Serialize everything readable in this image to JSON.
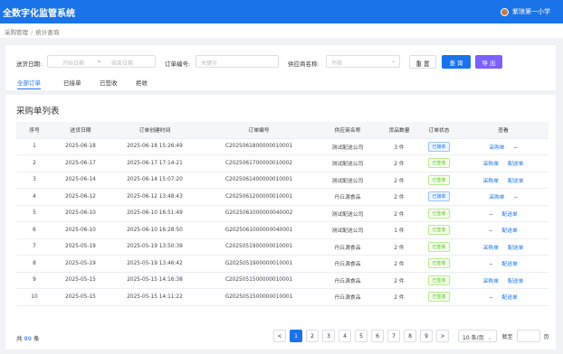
{
  "header": {
    "title": "全数字化监管系统",
    "user": "紫琅第一小学"
  },
  "breadcrumb": [
    "采购管理",
    "统计查询"
  ],
  "filters": {
    "date_label": "送货日期:",
    "date_start_placeholder": "开始日期",
    "date_sep": "~",
    "date_end_placeholder": "结束日期",
    "order_label": "订单编号:",
    "order_placeholder": "关键字",
    "supplier_label": "供应商名称:",
    "supplier_placeholder": "不限",
    "reset_label": "重 置",
    "search_label": "查 询",
    "export_label": "导 出"
  },
  "tabs": [
    {
      "label": "全部订单",
      "active": true
    },
    {
      "label": "已接单",
      "active": false
    },
    {
      "label": "已签收",
      "active": false
    },
    {
      "label": "拒收",
      "active": false
    }
  ],
  "section_title": "采购单列表",
  "columns": [
    "序号",
    "送货日期",
    "订单创建时间",
    "订单编号",
    "供应商名称",
    "货品数量",
    "订单状态",
    "查看"
  ],
  "rows": [
    {
      "no": "1",
      "date": "2025-06-18",
      "created": "2025-06-18 15:26:49",
      "order": "C2025061800000010001",
      "supplier": "测试配送公司",
      "qty": "3 件",
      "status": "已接单",
      "status_type": "blue",
      "view": [
        "采购单",
        "--"
      ]
    },
    {
      "no": "2",
      "date": "2025-06-17",
      "created": "2025-06-17 17:14:21",
      "order": "C2025061700000010002",
      "supplier": "测试配送公司",
      "qty": "2 件",
      "status": "已签收",
      "status_type": "green",
      "view": [
        "采购单",
        "配送单"
      ]
    },
    {
      "no": "3",
      "date": "2025-06-14",
      "created": "2025-06-14 15:07:20",
      "order": "C2025061400000010001",
      "supplier": "测试配送公司",
      "qty": "2 件",
      "status": "已签收",
      "status_type": "green",
      "view": [
        "采购单",
        "配送单"
      ]
    },
    {
      "no": "4",
      "date": "2025-06-12",
      "created": "2025-06-12 13:48:43",
      "order": "C2025061200000010001",
      "supplier": "丹丘源食品",
      "qty": "2 件",
      "status": "已接单",
      "status_type": "blue",
      "view": [
        "采购单",
        "--"
      ]
    },
    {
      "no": "5",
      "date": "2025-06-10",
      "created": "2025-06-10 16:51:49",
      "order": "G2025061000000040002",
      "supplier": "测试配送公司",
      "qty": "2 件",
      "status": "已签收",
      "status_type": "green",
      "view": [
        "--",
        "配送单"
      ]
    },
    {
      "no": "6",
      "date": "2025-06-10",
      "created": "2025-06-10 16:28:50",
      "order": "G2025061000000040001",
      "supplier": "测试配送公司",
      "qty": "1 件",
      "status": "已签收",
      "status_type": "green",
      "view": [
        "--",
        "配送单"
      ]
    },
    {
      "no": "7",
      "date": "2025-05-19",
      "created": "2025-05-19 13:50:39",
      "order": "C2025051900000010001",
      "supplier": "丹丘源食品",
      "qty": "2 件",
      "status": "已签收",
      "status_type": "green",
      "view": [
        "采购单",
        "配送单"
      ]
    },
    {
      "no": "8",
      "date": "2025-05-19",
      "created": "2025-05-19 13:46:42",
      "order": "G2025051900000010001",
      "supplier": "丹丘源食品",
      "qty": "2 件",
      "status": "已签收",
      "status_type": "green",
      "view": [
        "--",
        "配送单"
      ]
    },
    {
      "no": "9",
      "date": "2025-05-15",
      "created": "2025-05-15 14:16:38",
      "order": "C2025051500000010001",
      "supplier": "丹丘源食品",
      "qty": "2 件",
      "status": "已签收",
      "status_type": "green",
      "view": [
        "采购单",
        "配送单"
      ]
    },
    {
      "no": "10",
      "date": "2025-05-15",
      "created": "2025-05-15 14:11:22",
      "order": "G2025051500000010001",
      "supplier": "丹丘源食品",
      "qty": "2 件",
      "status": "已签收",
      "status_type": "green",
      "view": [
        "--",
        "配送单"
      ]
    }
  ],
  "footer": {
    "total_prefix": "共",
    "total_count": "89",
    "total_suffix": "条"
  },
  "pagination": {
    "prev": "<",
    "pages": [
      "1",
      "2",
      "3",
      "4",
      "5",
      "6",
      "7",
      "8",
      "9"
    ],
    "current": "1",
    "next": ">",
    "page_size": "10 条/页",
    "goto_label": "就至",
    "goto_suffix": "页"
  },
  "colors": {
    "primary": "#1a73e8",
    "export": "#7b61ff",
    "signed": "#52c41a"
  }
}
